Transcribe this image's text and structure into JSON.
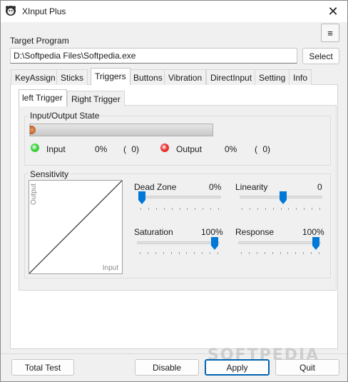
{
  "window": {
    "title": "XInput Plus",
    "close_glyph": "✕"
  },
  "header": {
    "target_program_label": "Target Program",
    "target_path": "D:\\Softpedia Files\\Softpedia.exe",
    "select_label": "Select",
    "menu_glyph": "≡"
  },
  "tabs": [
    {
      "label": "KeyAssign"
    },
    {
      "label": "Sticks"
    },
    {
      "label": "Triggers"
    },
    {
      "label": "Buttons"
    },
    {
      "label": "Vibration"
    },
    {
      "label": "DirectInput"
    },
    {
      "label": "Setting"
    },
    {
      "label": "Info"
    }
  ],
  "subtabs": [
    {
      "label": "left Trigger"
    },
    {
      "label": "Right Trigger"
    }
  ],
  "io_state": {
    "title": "Input/Output State",
    "bar_level": 0.0,
    "input_label": "Input",
    "input_percent": "0%",
    "input_raw": "( 0)",
    "output_label": "Output",
    "output_percent": "0%",
    "output_raw": "( 0)",
    "input_led_color": "#3bd13b",
    "output_led_color": "#e83030"
  },
  "sensitivity": {
    "title": "Sensitivity",
    "curve_output_label": "Output",
    "curve_input_label": "Input",
    "sliders": {
      "dead_zone": {
        "label": "Dead Zone",
        "value": "0%",
        "level": 0.0
      },
      "linearity": {
        "label": "Linearity",
        "value": "0",
        "level": 0.5
      },
      "saturation": {
        "label": "Saturation",
        "value": "100%",
        "level": 1.0
      },
      "response": {
        "label": "Response",
        "value": "100%",
        "level": 1.0
      }
    }
  },
  "footer": {
    "total_test_label": "Total Test",
    "disable_label": "Disable",
    "apply_label": "Apply",
    "quit_label": "Quit"
  },
  "watermark": "SOFTPEDIA",
  "colors": {
    "accent": "#0078d7"
  }
}
